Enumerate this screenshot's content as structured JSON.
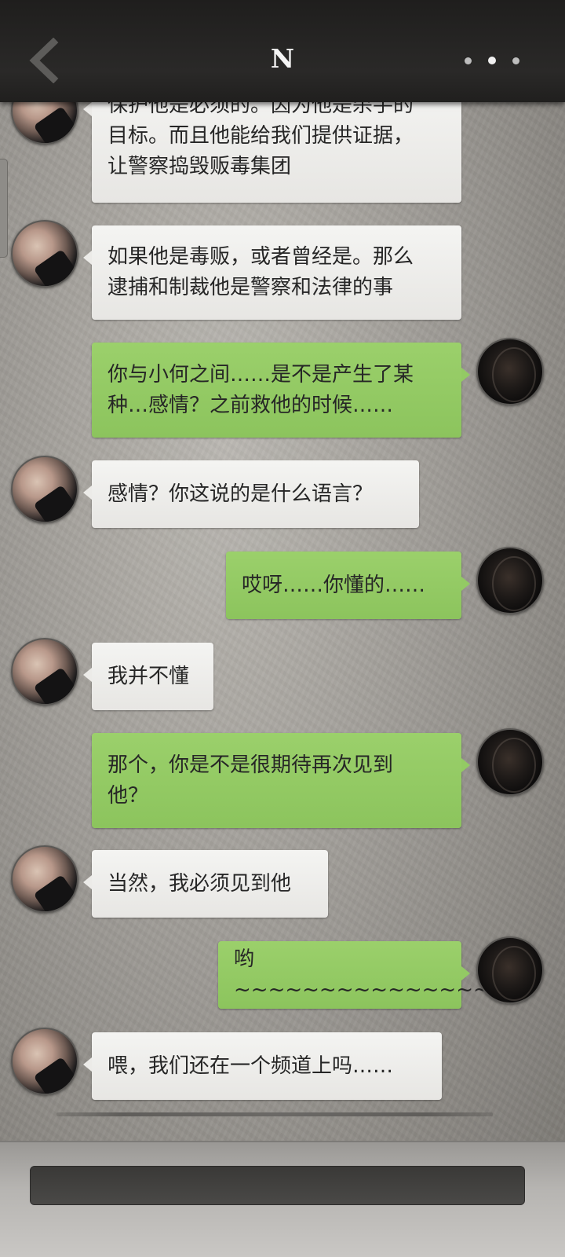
{
  "header": {
    "title": "N",
    "back_icon": "chevron-left-icon",
    "more_icon": "more-dots-icon"
  },
  "messages": [
    {
      "side": "in",
      "text": "保护他是必须的。因为他是杀手的\n目标。而且他能给我们提供证据，\n让警察捣毁贩毒集团"
    },
    {
      "side": "in",
      "text": "如果他是毒贩，或者曾经是。那么\n逮捕和制裁他是警察和法律的事"
    },
    {
      "side": "out",
      "text": "你与小何之间……是不是产生了某\n种…感情？之前救他的时候……"
    },
    {
      "side": "in",
      "text": "感情？你这说的是什么语言？"
    },
    {
      "side": "out",
      "text": "哎呀……你懂的……"
    },
    {
      "side": "in",
      "text": "我并不懂"
    },
    {
      "side": "out",
      "text": "那个，你是不是很期待再次见到\n他？"
    },
    {
      "side": "in",
      "text": "当然，我必须见到他"
    },
    {
      "side": "out",
      "text": "哟~~~~~~~~~~~~~~~"
    },
    {
      "side": "in",
      "text": "喂，我们还在一个频道上吗……"
    }
  ],
  "input": {
    "value": "",
    "placeholder": ""
  },
  "colors": {
    "incoming_bubble": "#eeeeec",
    "outgoing_bubble": "#93ca64",
    "header_bg": "#262524"
  }
}
